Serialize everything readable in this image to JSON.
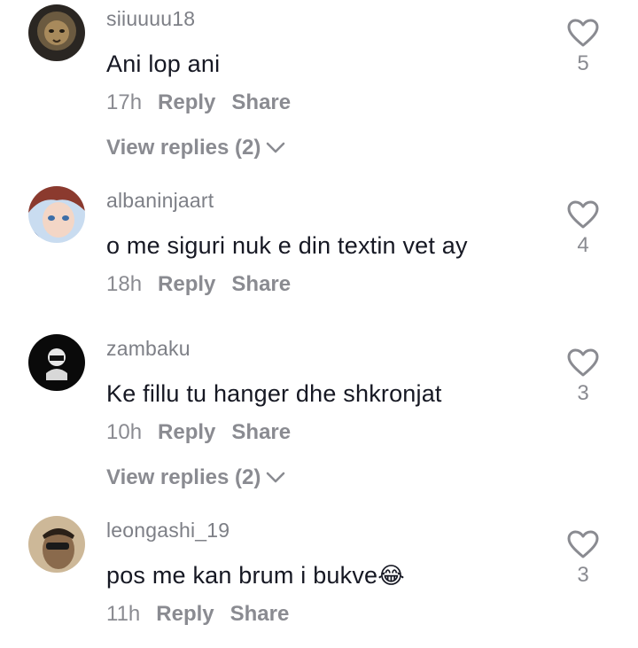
{
  "comments": [
    {
      "username": "siiuuuu18",
      "text": "Ani lop ani",
      "time": "17h",
      "reply_label": "Reply",
      "share_label": "Share",
      "likes": "5",
      "view_replies": "View replies (2)"
    },
    {
      "username": "albaninjaart",
      "text": "o me siguri nuk e din textin vet ay",
      "time": "18h",
      "reply_label": "Reply",
      "share_label": "Share",
      "likes": "4"
    },
    {
      "username": "zambaku",
      "text": "Ke fillu tu hanger dhe shkronjat",
      "time": "10h",
      "reply_label": "Reply",
      "share_label": "Share",
      "likes": "3",
      "view_replies": "View replies (2)"
    },
    {
      "username": "leongashi_19",
      "text": "pos me kan brum i bukve",
      "emoji": "😂",
      "time": "11h",
      "reply_label": "Reply",
      "share_label": "Share",
      "likes": "3"
    }
  ]
}
